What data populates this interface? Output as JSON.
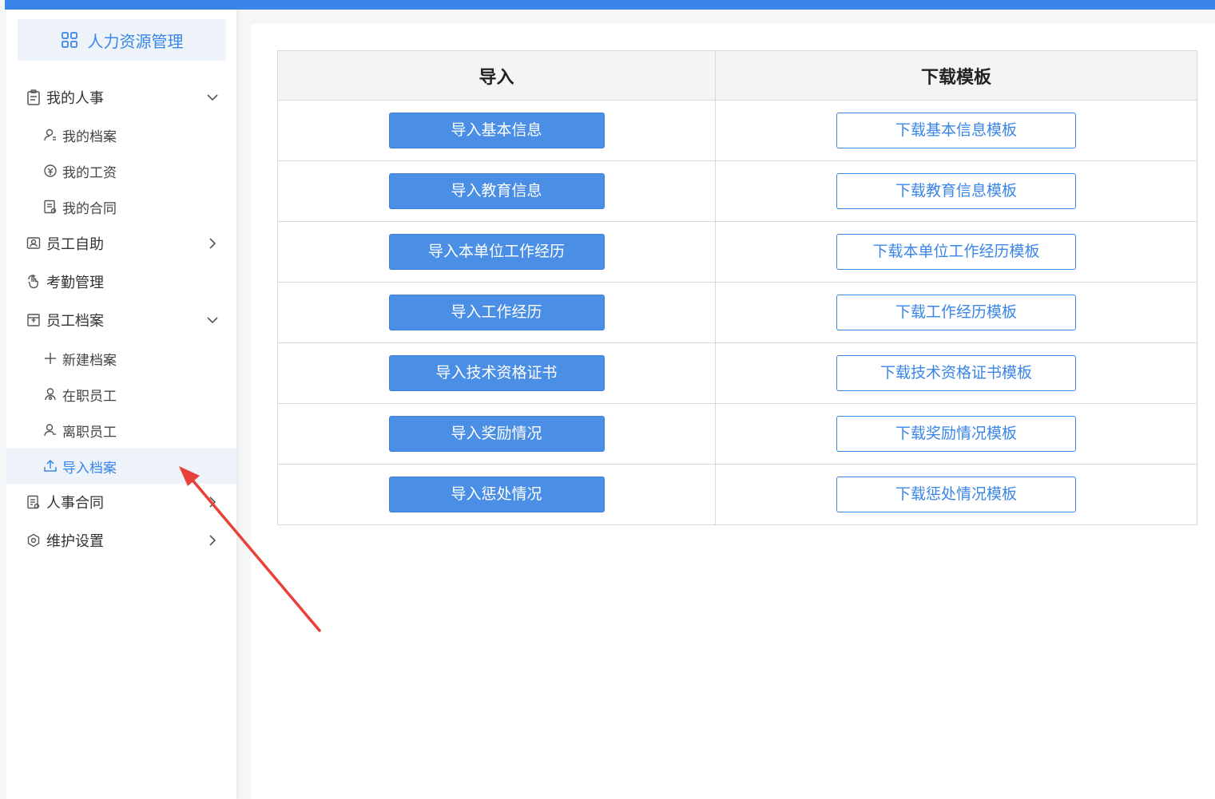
{
  "app": {
    "accent_color": "#3a86e8",
    "title": "人力资源管理"
  },
  "sidebar": {
    "items": [
      {
        "label": "我的人事",
        "icon": "clipboard-icon",
        "arrow": "chevron-down-icon"
      },
      {
        "label": "我的档案",
        "icon": "user-icon"
      },
      {
        "label": "我的工资",
        "icon": "money-icon"
      },
      {
        "label": "我的合同",
        "icon": "document-icon"
      },
      {
        "label": "员工自助",
        "icon": "self-service-icon",
        "arrow": "chevron-right-icon"
      },
      {
        "label": "考勤管理",
        "icon": "hand-tap-icon"
      },
      {
        "label": "员工档案",
        "icon": "archive-icon",
        "arrow": "chevron-down-icon"
      },
      {
        "label": "新建档案",
        "icon": "plus-icon"
      },
      {
        "label": "在职员工",
        "icon": "user-active-icon"
      },
      {
        "label": "离职员工",
        "icon": "user-left-icon"
      },
      {
        "label": "导入档案",
        "icon": "upload-icon",
        "active": true
      },
      {
        "label": "人事合同",
        "icon": "contract-icon",
        "arrow": "chevron-right-icon"
      },
      {
        "label": "维护设置",
        "icon": "settings-icon",
        "arrow": "chevron-right-icon"
      }
    ]
  },
  "table": {
    "headers": [
      "导入",
      "下载模板"
    ],
    "rows": [
      {
        "import": "导入基本信息",
        "download": "下载基本信息模板"
      },
      {
        "import": "导入教育信息",
        "download": "下载教育信息模板"
      },
      {
        "import": "导入本单位工作经历",
        "download": "下载本单位工作经历模板"
      },
      {
        "import": "导入工作经历",
        "download": "下载工作经历模板"
      },
      {
        "import": "导入技术资格证书",
        "download": "下载技术资格证书模板"
      },
      {
        "import": "导入奖励情况",
        "download": "下载奖励情况模板"
      },
      {
        "import": "导入惩处情况",
        "download": "下载惩处情况模板"
      }
    ]
  },
  "annotation": {
    "arrow_color": "#e8413a"
  }
}
